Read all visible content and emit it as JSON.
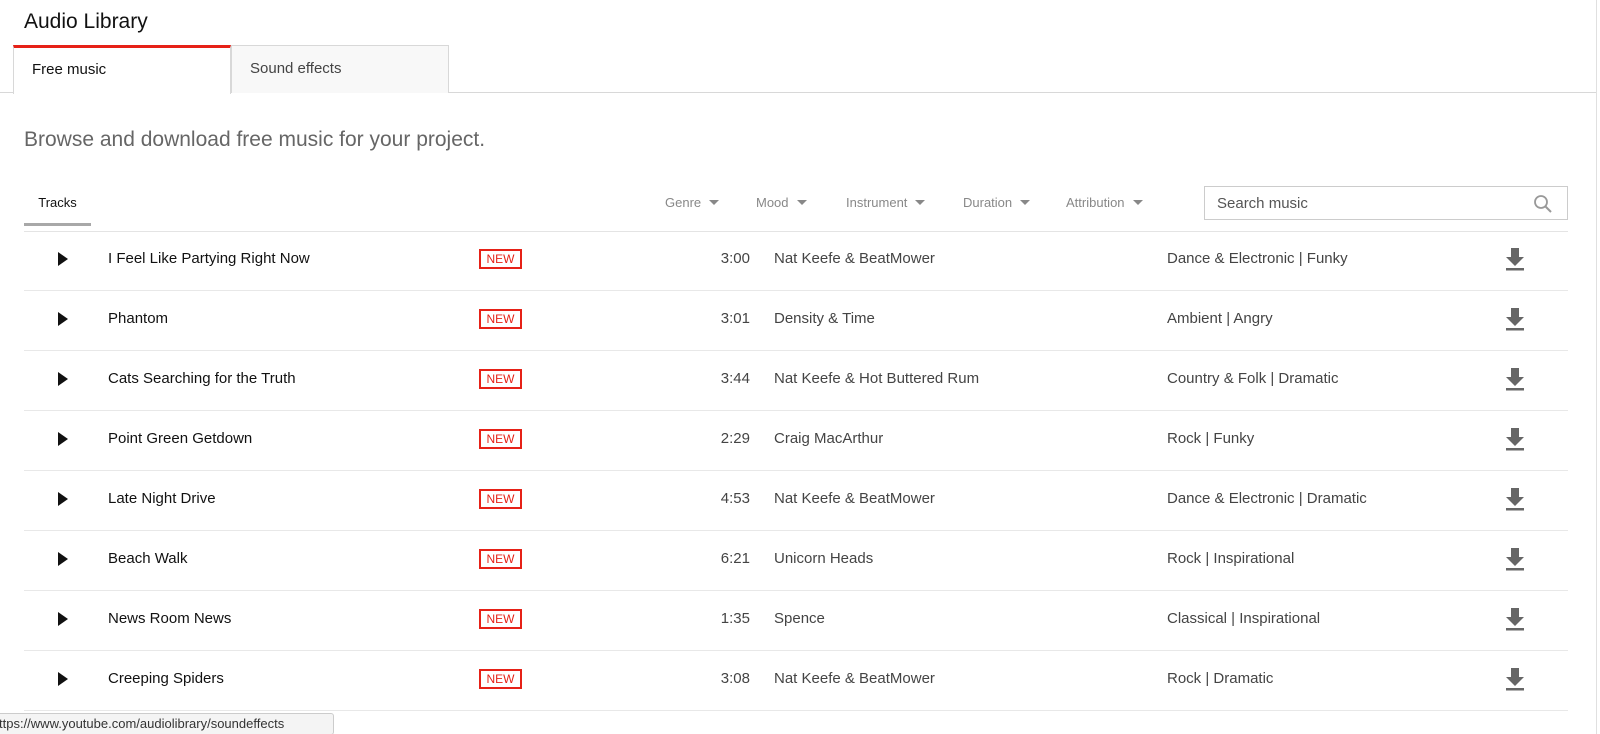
{
  "header": {
    "title": "Audio Library"
  },
  "tabs": [
    {
      "label": "Free music",
      "active": true
    },
    {
      "label": "Sound effects",
      "active": false
    }
  ],
  "subtitle": "Browse and download free music for your project.",
  "filter_bar": {
    "tracks_tab": "Tracks",
    "filters": [
      "Genre",
      "Mood",
      "Instrument",
      "Duration",
      "Attribution"
    ],
    "search_placeholder": "Search music"
  },
  "tracks": [
    {
      "title": "I Feel Like Partying Right Now",
      "badge": "NEW",
      "duration": "3:00",
      "artist": "Nat Keefe & BeatMower",
      "genre_mood": "Dance & Electronic | Funky"
    },
    {
      "title": "Phantom",
      "badge": "NEW",
      "duration": "3:01",
      "artist": "Density & Time",
      "genre_mood": "Ambient | Angry"
    },
    {
      "title": "Cats Searching for the Truth",
      "badge": "NEW",
      "duration": "3:44",
      "artist": "Nat Keefe & Hot Buttered Rum",
      "genre_mood": "Country & Folk | Dramatic"
    },
    {
      "title": "Point Green Getdown",
      "badge": "NEW",
      "duration": "2:29",
      "artist": "Craig MacArthur",
      "genre_mood": "Rock | Funky"
    },
    {
      "title": "Late Night Drive",
      "badge": "NEW",
      "duration": "4:53",
      "artist": "Nat Keefe & BeatMower",
      "genre_mood": "Dance & Electronic | Dramatic"
    },
    {
      "title": "Beach Walk",
      "badge": "NEW",
      "duration": "6:21",
      "artist": "Unicorn Heads",
      "genre_mood": "Rock | Inspirational"
    },
    {
      "title": "News Room News",
      "badge": "NEW",
      "duration": "1:35",
      "artist": "Spence",
      "genre_mood": "Classical | Inspirational"
    },
    {
      "title": "Creeping Spiders",
      "badge": "NEW",
      "duration": "3:08",
      "artist": "Nat Keefe & BeatMower",
      "genre_mood": "Rock | Dramatic"
    }
  ],
  "status_bar": {
    "url": "ttps://www.youtube.com/audiolibrary/soundeffects"
  },
  "colors": {
    "accent": "#e62117",
    "text": "#111111",
    "muted": "#666666"
  },
  "icons": {
    "play": "play-icon",
    "download": "download-icon",
    "search": "search-icon",
    "caret": "caret-down-icon"
  }
}
